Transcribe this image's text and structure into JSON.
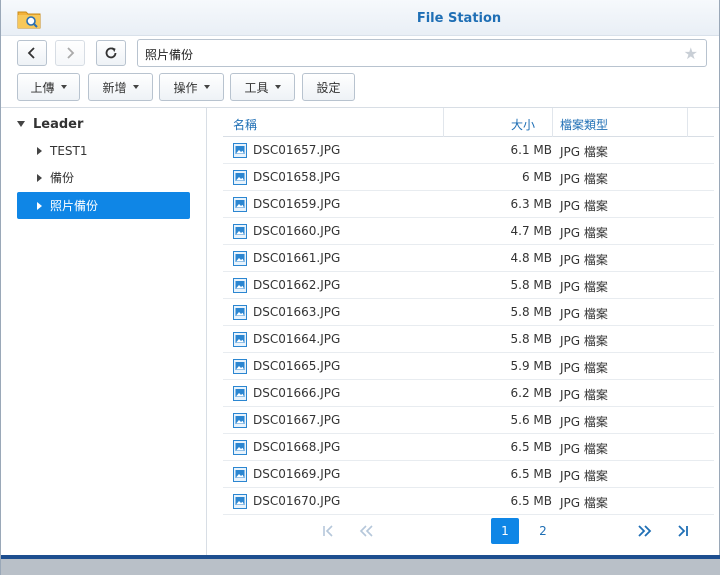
{
  "window": {
    "title": "File Station"
  },
  "nav": {
    "path": "照片備份"
  },
  "toolbar": {
    "upload": "上傳",
    "create": "新增",
    "action": "操作",
    "tools": "工具",
    "settings": "設定"
  },
  "sidebar": {
    "root": "Leader",
    "items": [
      {
        "label": "TEST1"
      },
      {
        "label": "備份"
      },
      {
        "label": "照片備份"
      }
    ],
    "selected_index": 2
  },
  "filelist": {
    "columns": {
      "name": "名稱",
      "size": "大小",
      "type": "檔案類型"
    },
    "rows": [
      {
        "name": "DSC01657.JPG",
        "size": "6.1 MB",
        "type": "JPG 檔案"
      },
      {
        "name": "DSC01658.JPG",
        "size": "6 MB",
        "type": "JPG 檔案"
      },
      {
        "name": "DSC01659.JPG",
        "size": "6.3 MB",
        "type": "JPG 檔案"
      },
      {
        "name": "DSC01660.JPG",
        "size": "4.7 MB",
        "type": "JPG 檔案"
      },
      {
        "name": "DSC01661.JPG",
        "size": "4.8 MB",
        "type": "JPG 檔案"
      },
      {
        "name": "DSC01662.JPG",
        "size": "5.8 MB",
        "type": "JPG 檔案"
      },
      {
        "name": "DSC01663.JPG",
        "size": "5.8 MB",
        "type": "JPG 檔案"
      },
      {
        "name": "DSC01664.JPG",
        "size": "5.8 MB",
        "type": "JPG 檔案"
      },
      {
        "name": "DSC01665.JPG",
        "size": "5.9 MB",
        "type": "JPG 檔案"
      },
      {
        "name": "DSC01666.JPG",
        "size": "6.2 MB",
        "type": "JPG 檔案"
      },
      {
        "name": "DSC01667.JPG",
        "size": "5.6 MB",
        "type": "JPG 檔案"
      },
      {
        "name": "DSC01668.JPG",
        "size": "6.5 MB",
        "type": "JPG 檔案"
      },
      {
        "name": "DSC01669.JPG",
        "size": "6.5 MB",
        "type": "JPG 檔案"
      },
      {
        "name": "DSC01670.JPG",
        "size": "6.5 MB",
        "type": "JPG 檔案"
      }
    ]
  },
  "pager": {
    "pages": [
      "1",
      "2"
    ],
    "current_page": "1"
  },
  "colors": {
    "accent": "#0f86e6",
    "title_blue": "#1f6fb5",
    "header_blue": "#1f6fb5",
    "bottom_bar": "#1d4e8f"
  }
}
